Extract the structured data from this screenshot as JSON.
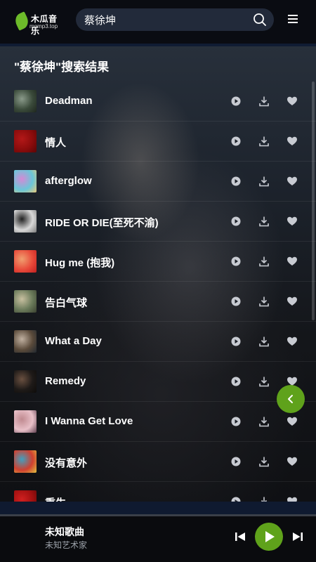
{
  "app": {
    "logo_title": "木瓜音乐",
    "logo_subtitle": "mgmp3.top"
  },
  "search": {
    "value": "蔡徐坤",
    "placeholder": ""
  },
  "results": {
    "title": "\"蔡徐坤\"搜索结果",
    "songs": [
      {
        "name": "Deadman",
        "cover": [
          "#3a4a3a",
          "#8a9a8a",
          "#1e261e"
        ]
      },
      {
        "name": "情人",
        "cover": [
          "#8b0c0c",
          "#b31818",
          "#5a0606"
        ]
      },
      {
        "name": "afterglow",
        "cover": [
          "#6ac7d8",
          "#d48ad6",
          "#e8c87a"
        ]
      },
      {
        "name": "RIDE OR DIE(至死不渝)",
        "cover": [
          "#d8d8d8",
          "#202020",
          "#7a7a7a"
        ]
      },
      {
        "name": "Hug me (抱我)",
        "cover": [
          "#e84a3a",
          "#f0a070",
          "#c02020"
        ]
      },
      {
        "name": "告白气球",
        "cover": [
          "#6a7a5a",
          "#c8c0a0",
          "#3a4030"
        ]
      },
      {
        "name": "What a Day",
        "cover": [
          "#5a4a3a",
          "#c0b0a0",
          "#202830"
        ]
      },
      {
        "name": "Remedy",
        "cover": [
          "#1e1a18",
          "#6a5040",
          "#0e0c0a"
        ]
      },
      {
        "name": "I Wanna Get Love",
        "cover": [
          "#e8c0c8",
          "#c08a90",
          "#604050"
        ]
      },
      {
        "name": "没有意外",
        "cover": [
          "#d04030",
          "#40a0c0",
          "#e0c040"
        ]
      },
      {
        "name": "重生",
        "cover": [
          "#a01010",
          "#d02020",
          "#600808"
        ]
      }
    ]
  },
  "player": {
    "title": "未知歌曲",
    "artist": "未知艺术家"
  },
  "colors": {
    "accent": "#5fa21b",
    "icon": "#c8cbd2"
  }
}
